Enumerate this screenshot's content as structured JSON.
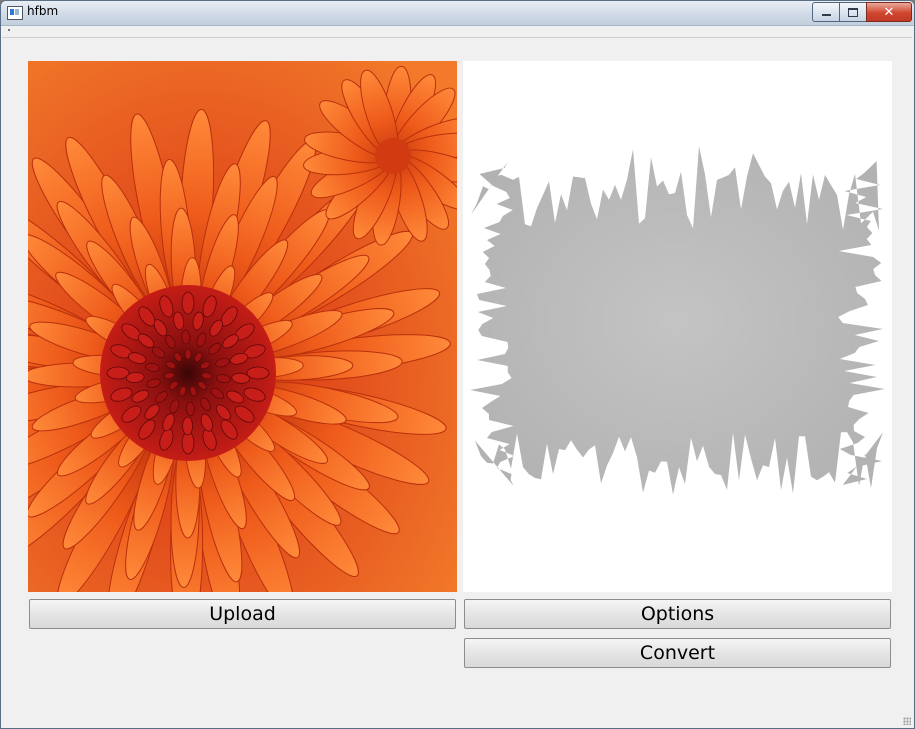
{
  "window": {
    "title": "hfbm",
    "controls": {
      "close_glyph": "✕"
    }
  },
  "images": {
    "source": {
      "subject": "orange chrysanthemum flower photo"
    },
    "result": {
      "subject": "gray heightfield silhouette on white"
    }
  },
  "buttons": {
    "upload_label": "Upload",
    "options_label": "Options",
    "convert_label": "Convert"
  },
  "colors": {
    "flower_orange": "#e85a1a",
    "flower_red": "#b01818",
    "map_gray": "#bdbdbd",
    "window_bg": "#f0f0f0"
  }
}
